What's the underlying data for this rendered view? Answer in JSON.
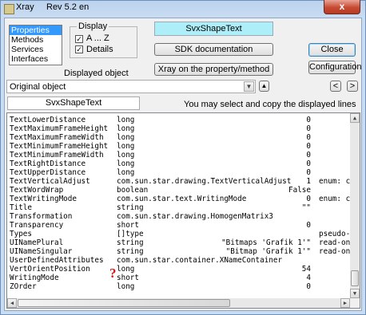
{
  "window": {
    "title": "Xray",
    "version": "Rev 5.2 en",
    "close_glyph": "x"
  },
  "mode_list": {
    "items": [
      "Properties",
      "Methods",
      "Services",
      "Interfaces"
    ],
    "selected": 0
  },
  "display_group": {
    "title": "Display",
    "sort_label": "A ... Z",
    "details_label": "Details",
    "sort_checked": true,
    "details_checked": true
  },
  "displayed_object_label": "Displayed object",
  "object_box_text": "SvxShapeText",
  "buttons": {
    "sdk_doc": "SDK documentation",
    "xray_prop": "Xray on the property/method",
    "close": "Close",
    "config": "Configuration",
    "nav_prev": "<",
    "nav_next": ">"
  },
  "object_combo": {
    "value": "Original object",
    "dropdown_glyph": "▼",
    "up_glyph": "▲"
  },
  "object_name_field": "SvxShapeText",
  "hint": "You may select and copy the displayed lines",
  "rows": [
    {
      "name": "TextLowerDistance",
      "type": "long",
      "value": "0",
      "extra": ""
    },
    {
      "name": "TextMaximumFrameHeight",
      "type": "long",
      "value": "0",
      "extra": ""
    },
    {
      "name": "TextMaximumFrameWidth",
      "type": "long",
      "value": "0",
      "extra": ""
    },
    {
      "name": "TextMinimumFrameHeight",
      "type": "long",
      "value": "0",
      "extra": ""
    },
    {
      "name": "TextMinimumFrameWidth",
      "type": "long",
      "value": "0",
      "extra": ""
    },
    {
      "name": "TextRightDistance",
      "type": "long",
      "value": "0",
      "extra": ""
    },
    {
      "name": "TextUpperDistance",
      "type": "long",
      "value": "0",
      "extra": ""
    },
    {
      "name": "TextVerticalAdjust",
      "type": "com.sun.star.drawing.TextVerticalAdjust",
      "value": "1",
      "extra": "enum: c"
    },
    {
      "name": "TextWordWrap",
      "type": "boolean",
      "value": "False",
      "extra": ""
    },
    {
      "name": "TextWritingMode",
      "type": "com.sun.star.text.WritingMode",
      "value": "0",
      "extra": "enum: c"
    },
    {
      "name": "Title",
      "type": "string",
      "value": "\"\"",
      "extra": ""
    },
    {
      "name": "Transformation",
      "type": "com.sun.star.drawing.HomogenMatrix3",
      "value": "",
      "extra": ""
    },
    {
      "name": "Transparency",
      "type": "short",
      "value": "0",
      "extra": ""
    },
    {
      "name": "Types",
      "type": "[]type",
      "value": "",
      "extra": "pseudo-p"
    },
    {
      "name": "UINamePlural",
      "type": "string",
      "value": "\"Bitmaps 'Grafik 1'\"",
      "extra": "read-on"
    },
    {
      "name": "UINameSingular",
      "type": "string",
      "value": "\"Bitmap 'Grafik 1'\"",
      "extra": "read-on"
    },
    {
      "name": "UserDefinedAttributes",
      "type": "com.sun.star.container.XNameContainer",
      "value": "",
      "extra": ""
    },
    {
      "name": "VertOrientPosition",
      "type": "long",
      "value": "54",
      "extra": ""
    },
    {
      "name": "WritingMode",
      "type": "short",
      "value": "4",
      "extra": ""
    },
    {
      "name": "ZOrder",
      "type": "long",
      "value": "0",
      "extra": ""
    }
  ],
  "annotation_mark": "?"
}
